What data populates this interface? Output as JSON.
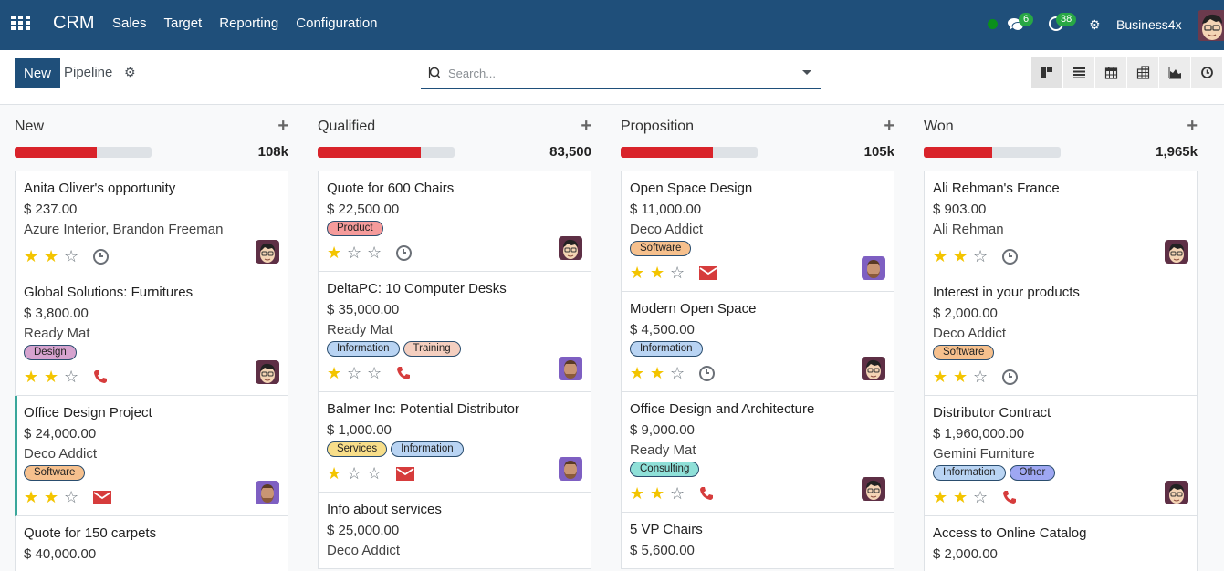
{
  "navbar": {
    "brand": "CRM",
    "menu": [
      "Sales",
      "Target",
      "Reporting",
      "Configuration"
    ],
    "messages_count": "6",
    "activities_count": "38",
    "company": "Business4x"
  },
  "control": {
    "new_label": "New",
    "breadcrumb": "Pipeline",
    "search_placeholder": "Search...",
    "views": [
      "kanban-view",
      "list-view",
      "calendar-view",
      "pivot-view",
      "graph-view",
      "activity-view"
    ]
  },
  "colors": {
    "navbar": "#1f4f7a",
    "progress_red": "#d9232a",
    "star": "#f3c400",
    "accent_border": "#3aa79b"
  },
  "columns": [
    {
      "title": "New",
      "total": "108k",
      "progress": 0.6,
      "cards": [
        {
          "title": "Anita Oliver's opportunity",
          "amount": "$ 237.00",
          "partner": "Azure Interior, Brandon Freeman",
          "tags": [],
          "stars": 2,
          "activity": "clock",
          "avatar": "a"
        },
        {
          "title": "Global Solutions: Furnitures",
          "amount": "$ 3,800.00",
          "partner": "Ready Mat",
          "tags": [
            {
              "label": "Design",
              "color": "#d6a3cf"
            }
          ],
          "stars": 2,
          "activity": "phone",
          "avatar": "a"
        },
        {
          "title": "Office Design Project",
          "amount": "$ 24,000.00",
          "partner": "Deco Addict",
          "tags": [
            {
              "label": "Software",
              "color": "#f6c08d"
            }
          ],
          "stars": 2,
          "activity": "email",
          "avatar": "b",
          "accent": true
        },
        {
          "title": "Quote for 150 carpets",
          "amount": "$ 40,000.00",
          "partner": "",
          "tags": [],
          "stars": 0,
          "activity": "",
          "avatar": ""
        }
      ]
    },
    {
      "title": "Qualified",
      "total": "83,500",
      "progress": 0.75,
      "cards": [
        {
          "title": "Quote for 600 Chairs",
          "amount": "$ 22,500.00",
          "partner": "",
          "tags": [
            {
              "label": "Product",
              "color": "#f59b9b"
            }
          ],
          "stars": 1,
          "activity": "clock",
          "avatar": "a"
        },
        {
          "title": "DeltaPC: 10 Computer Desks",
          "amount": "$ 35,000.00",
          "partner": "Ready Mat",
          "tags": [
            {
              "label": "Information",
              "color": "#b9d4f3"
            },
            {
              "label": "Training",
              "color": "#f4cfc0"
            }
          ],
          "stars": 1,
          "activity": "phone",
          "avatar": "b"
        },
        {
          "title": "Balmer Inc: Potential Distributor",
          "amount": "$ 1,000.00",
          "partner": "",
          "tags": [
            {
              "label": "Services",
              "color": "#f7de8a"
            },
            {
              "label": "Information",
              "color": "#b9d4f3"
            }
          ],
          "stars": 1,
          "activity": "email",
          "avatar": "b"
        },
        {
          "title": "Info about services",
          "amount": "$ 25,000.00",
          "partner": "Deco Addict",
          "tags": [],
          "stars": 0,
          "activity": "",
          "avatar": ""
        }
      ]
    },
    {
      "title": "Proposition",
      "total": "105k",
      "progress": 0.67,
      "cards": [
        {
          "title": "Open Space Design",
          "amount": "$ 11,000.00",
          "partner": "Deco Addict",
          "tags": [
            {
              "label": "Software",
              "color": "#f6c08d"
            }
          ],
          "stars": 2,
          "activity": "email",
          "avatar": "b"
        },
        {
          "title": "Modern Open Space",
          "amount": "$ 4,500.00",
          "partner": "",
          "tags": [
            {
              "label": "Information",
              "color": "#b9d4f3"
            }
          ],
          "stars": 2,
          "activity": "clock",
          "avatar": "a"
        },
        {
          "title": "Office Design and Architecture",
          "amount": "$ 9,000.00",
          "partner": "Ready Mat",
          "tags": [
            {
              "label": "Consulting",
              "color": "#8fe0d8"
            }
          ],
          "stars": 2,
          "activity": "phone",
          "avatar": "a"
        },
        {
          "title": "5 VP Chairs",
          "amount": "$ 5,600.00",
          "partner": "",
          "tags": [],
          "stars": 0,
          "activity": "",
          "avatar": ""
        }
      ]
    },
    {
      "title": "Won",
      "total": "1,965k",
      "progress": 0.5,
      "cards": [
        {
          "title": "Ali Rehman's France",
          "amount": "$ 903.00",
          "partner": "Ali Rehman",
          "tags": [],
          "stars": 2,
          "activity": "clock",
          "avatar": "a"
        },
        {
          "title": "Interest in your products",
          "amount": "$ 2,000.00",
          "partner": "Deco Addict",
          "tags": [
            {
              "label": "Software",
              "color": "#f6c08d"
            }
          ],
          "stars": 2,
          "activity": "clock",
          "avatar": ""
        },
        {
          "title": "Distributor Contract",
          "amount": "$ 1,960,000.00",
          "partner": "Gemini Furniture",
          "tags": [
            {
              "label": "Information",
              "color": "#b9d4f3"
            },
            {
              "label": "Other",
              "color": "#9ea7f2"
            }
          ],
          "stars": 2,
          "activity": "phone",
          "avatar": "a"
        },
        {
          "title": "Access to Online Catalog",
          "amount": "$ 2,000.00",
          "partner": "",
          "tags": [],
          "stars": 0,
          "activity": "",
          "avatar": ""
        }
      ]
    }
  ]
}
